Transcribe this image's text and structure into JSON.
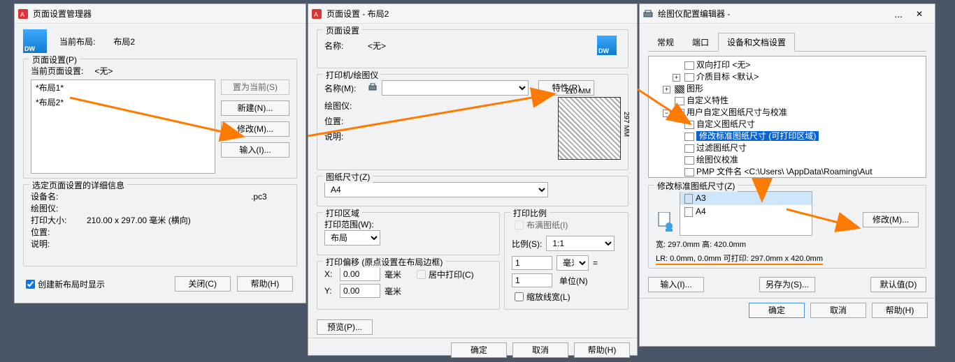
{
  "win1": {
    "title": "页面设置管理器",
    "current_layout_label": "当前布局:",
    "current_layout_value": "布局2",
    "group1_title": "页面设置(P)",
    "current_page_label": "当前页面设置:",
    "current_page_value": "<无>",
    "list_items": [
      "*布局1*",
      "*布局2*"
    ],
    "btn_set_current": "置为当前(S)",
    "btn_new": "新建(N)...",
    "btn_modify": "修改(M)...",
    "btn_import": "输入(I)...",
    "group2_title": "选定页面设置的详细信息",
    "info_device": "设备名:",
    "info_device_val": ".pc3",
    "info_plotter": "绘图仪:",
    "info_plotter_val": "",
    "info_size": "打印大小:",
    "info_size_val": "210.00 x 297.00 毫米 (横向)",
    "info_pos": "位置:",
    "info_pos_val": "",
    "info_desc": "说明:",
    "info_desc_val": "",
    "check_create": "创建新布局时显示",
    "btn_close": "关闭(C)",
    "btn_help": "帮助(H)"
  },
  "win2": {
    "title": "页面设置 - 布局2",
    "grp_page": "页面设置",
    "lbl_name": "名称:",
    "val_name": "<无>",
    "grp_printer": "打印机/绘图仪",
    "lbl_pname": "名称(M):",
    "btn_props": "特性(R)",
    "lbl_plotter": "绘图仪:",
    "lbl_pos": "位置:",
    "lbl_desc": "说明:",
    "paper_top": "210 MM",
    "paper_side": "297 MM",
    "grp_paper": "图纸尺寸(Z)",
    "paper_size": "A4",
    "grp_area": "打印区域",
    "lbl_range": "打印范围(W):",
    "val_range": "布局",
    "grp_offset": "打印偏移 (原点设置在布局边框)",
    "lbl_x": "X:",
    "lbl_y": "Y:",
    "val_x": "0.00",
    "val_y": "0.00",
    "lbl_mm": "毫米",
    "check_center": "居中打印(C)",
    "grp_scale": "打印比例",
    "check_fit": "布满图纸(I)",
    "lbl_scale": "比例(S):",
    "val_scale": "1:1",
    "val_one": "1",
    "lbl_mm2": "毫米",
    "lbl_eq": "=",
    "val_one2": "1",
    "lbl_unit": "单位(N)",
    "check_linew": "缩放线宽(L)",
    "btn_preview": "预览(P)...",
    "btn_ok": "确定",
    "btn_cancel": "取消",
    "btn_help": "帮助(H)"
  },
  "win3": {
    "title": "绘图仪配置编辑器 -",
    "tab1": "常规",
    "tab2": "端口",
    "tab3": "设备和文档设置",
    "tree": {
      "n1": "双向打印 <无>",
      "n2": "介质目标 <默认>",
      "n3": "图形",
      "n4": "自定义特性",
      "n5": "用户自定义图纸尺寸与校准",
      "n5_1": "自定义图纸尺寸",
      "n5_2": "修改标准图纸尺寸 (可打印区域)",
      "n5_3": "过滤图纸尺寸",
      "n5_4": "绘图仪校准",
      "n5_5": "PMP 文件名 <C:\\Users\\          \\AppData\\Roaming\\Aut"
    },
    "grp_modify": "修改标准图纸尺寸(Z)",
    "paper_a3": "A3",
    "paper_a4": "A4",
    "btn_modify": "修改(M)...",
    "size_wh": "宽: 297.0mm 高: 420.0mm",
    "size_lr": "LR: 0.0mm, 0.0mm 可打印: 297.0mm x 420.0mm",
    "btn_import": "输入(I)...",
    "btn_saveas": "另存为(S)...",
    "btn_default": "默认值(D)",
    "btn_ok": "确定",
    "btn_cancel": "取消",
    "btn_help": "帮助(H)"
  }
}
